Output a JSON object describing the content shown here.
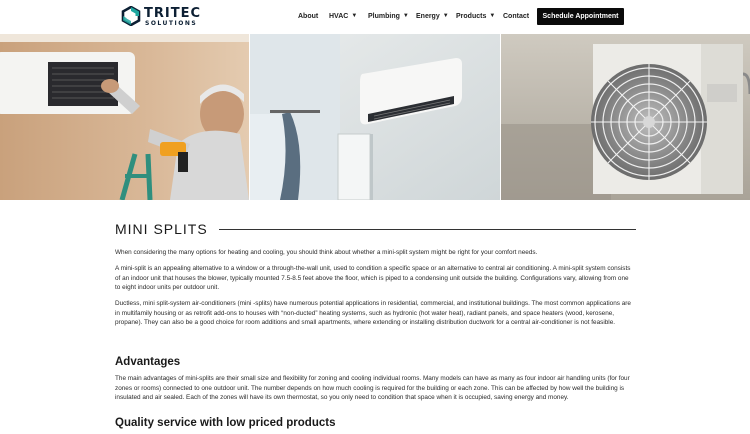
{
  "brand": {
    "name": "TRITEC",
    "tagline": "SOLUTIONS"
  },
  "nav": {
    "items": [
      {
        "label": "About",
        "has_dropdown": false
      },
      {
        "label": "HVAC",
        "has_dropdown": true
      },
      {
        "label": "Plumbing",
        "has_dropdown": true
      },
      {
        "label": "Energy",
        "has_dropdown": true
      },
      {
        "label": "Products",
        "has_dropdown": true
      },
      {
        "label": "Contact",
        "has_dropdown": false
      }
    ],
    "cta_label": "Schedule Appointment"
  },
  "colors": {
    "logo_teal": "#1fa7a0",
    "logo_navy": "#0c1f33",
    "cta_bg": "#0a0a0a"
  },
  "main": {
    "title": "MINI SPLITS",
    "intro": "When considering the many options for heating and cooling, you should think about whether a mini-split system might be right for your comfort needs.",
    "p1": "A mini-split is an appealing alternative to a window or a through-the-wall unit, used to condition a specific space or an alternative to central air conditioning. A mini-split system consists of an indoor unit that houses the blower, typically mounted 7.5-8.5 feet above the floor, which is piped to a condensing unit outside the building. Configurations vary, allowing from one to eight indoor units per outdoor unit.",
    "p2": "Ductless, mini split-system air-conditioners (mini -splits) have numerous potential applications in residential, commercial, and institutional buildings. The most common applications are in multifamily housing or as retrofit add-ons to houses with “non-ducted” heating systems, such as hydronic (hot water heat), radiant panels, and space heaters (wood, kerosene, propane). They can also be a good choice for room additions and small apartments, where extending or installing distribution ductwork for a central air-conditioner is not feasible.",
    "advantages_heading": "Advantages",
    "advantages_text": "The main advantages of mini-splits are their small size and flexibility for zoning and cooling individual rooms. Many models can have as many as four indoor air handling units (for four zones or rooms) connected to one outdoor unit. The number depends on how much cooling is required for the building or each zone. This can be affected by how well the building is insulated and air sealed. Each of the zones will have its own thermostat, so you only need to condition that space when it is occupied, saving energy and money.",
    "quality_heading": "Quality service with low priced products"
  }
}
